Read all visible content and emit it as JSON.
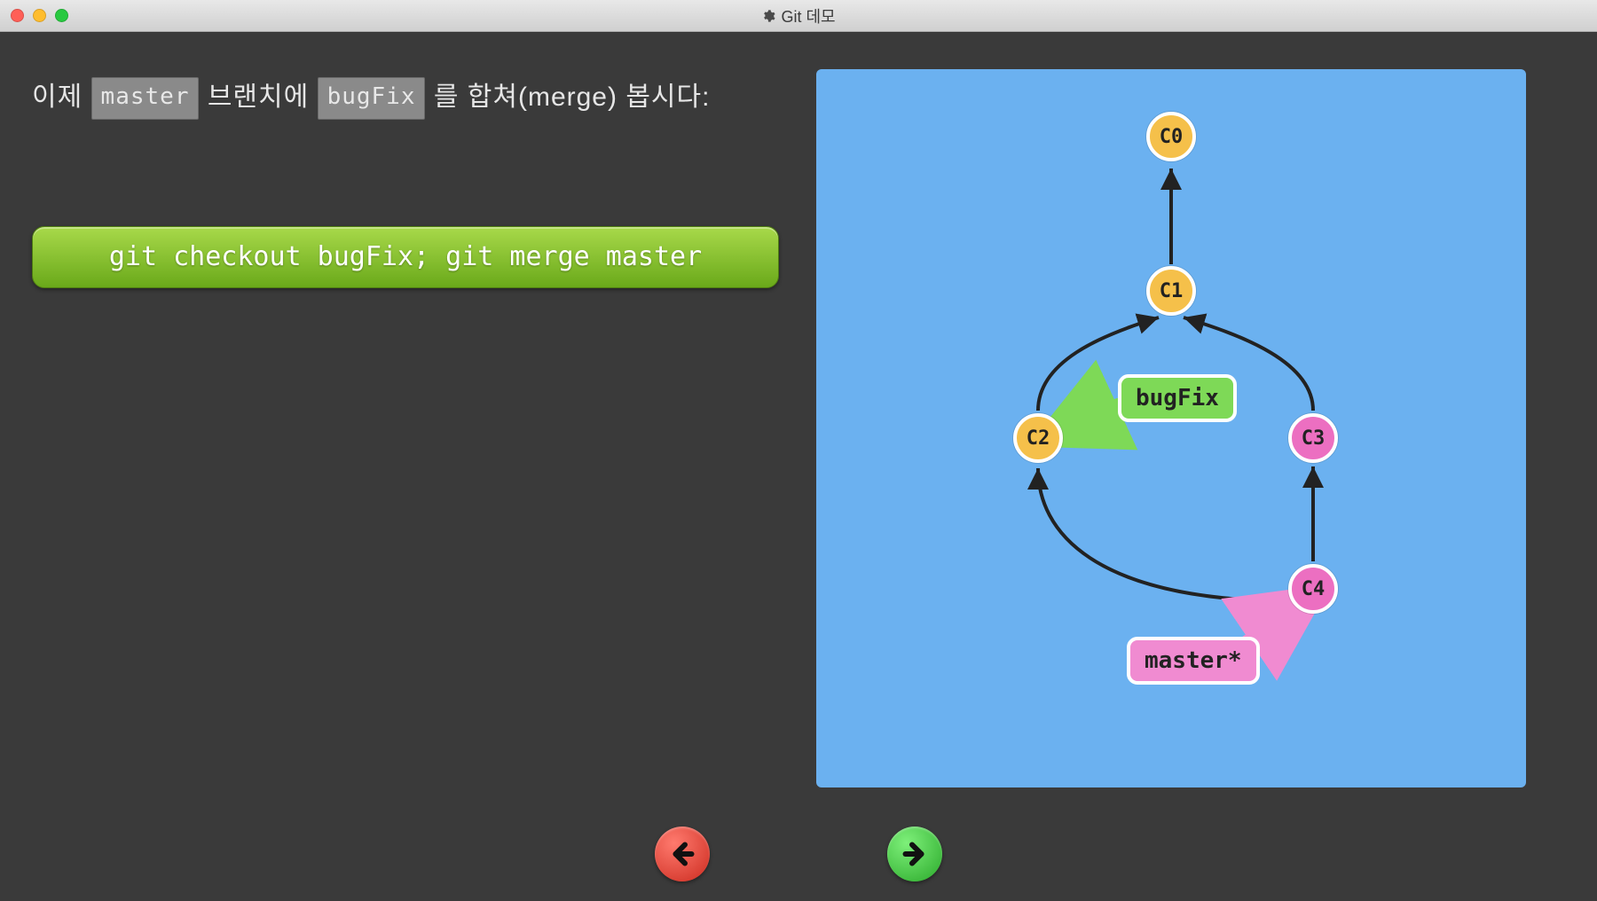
{
  "window": {
    "title": "Git 데모"
  },
  "instruction": {
    "part1": "이제",
    "chip1": "master",
    "part2": "브랜치에",
    "chip2": "bugFix",
    "part3": "를 합쳐(merge) 봅시다:"
  },
  "command": "git checkout bugFix; git merge master",
  "graph": {
    "commits": {
      "c0": "C0",
      "c1": "C1",
      "c2": "C2",
      "c3": "C3",
      "c4": "C4"
    },
    "branches": {
      "bugfix": "bugFix",
      "master": "master*"
    }
  },
  "nav": {
    "prev": "previous",
    "next": "next"
  }
}
